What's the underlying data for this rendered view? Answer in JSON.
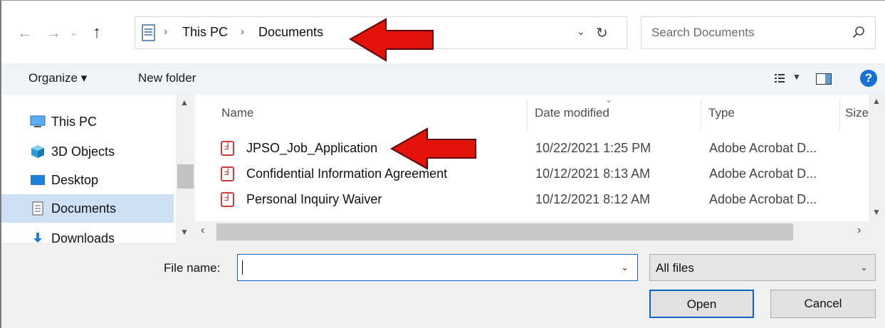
{
  "address": {
    "crumbs": [
      "This PC",
      "Documents"
    ],
    "search_placeholder": "Search Documents"
  },
  "toolbar": {
    "organize_label": "Organize ▾",
    "new_folder_label": "New folder",
    "help_label": "?"
  },
  "nav": {
    "items": [
      {
        "label": "This PC"
      },
      {
        "label": "3D Objects"
      },
      {
        "label": "Desktop"
      },
      {
        "label": "Documents",
        "selected": true
      },
      {
        "label": "Downloads"
      }
    ]
  },
  "files": {
    "columns": [
      "Name",
      "Date modified",
      "Type",
      "Size"
    ],
    "rows": [
      {
        "name": "JPSO_Job_Application",
        "date": "10/22/2021 1:25 PM",
        "type": "Adobe Acrobat D..."
      },
      {
        "name": "Confidential Information Agreement",
        "date": "10/12/2021 8:13 AM",
        "type": "Adobe Acrobat D..."
      },
      {
        "name": "Personal Inquiry Waiver",
        "date": "10/12/2021 8:12 AM",
        "type": "Adobe Acrobat D..."
      }
    ]
  },
  "bottom": {
    "file_name_label": "File name:",
    "file_name_value": "",
    "filter_value": "All files",
    "open_label": "Open",
    "cancel_label": "Cancel"
  },
  "colors": {
    "accent": "#0a64c8",
    "selection": "#cde0f4",
    "arrow_red": "#e3120b"
  }
}
